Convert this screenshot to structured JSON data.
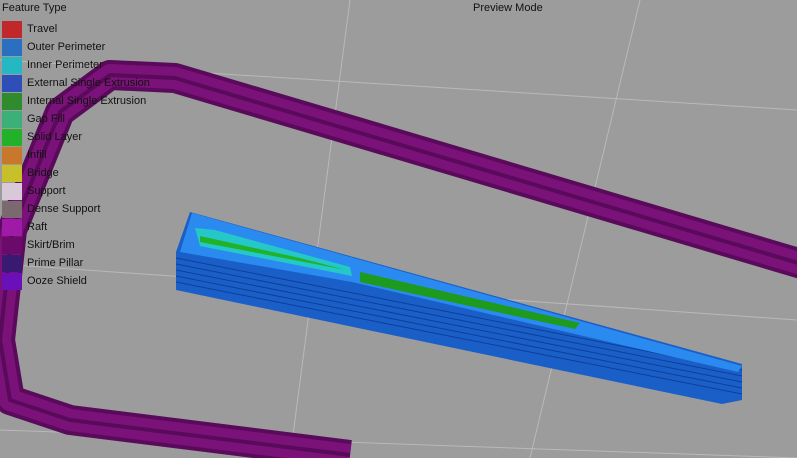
{
  "header": {
    "mode_label": "Preview Mode"
  },
  "legend": {
    "title": "Feature Type",
    "items": [
      {
        "label": "Travel",
        "color": "#c0282c"
      },
      {
        "label": "Outer Perimeter",
        "color": "#2a6fc0"
      },
      {
        "label": "Inner Perimeter",
        "color": "#25b7c2"
      },
      {
        "label": "External Single Extrusion",
        "color": "#2e4fb8"
      },
      {
        "label": "Internal Single Extrusion",
        "color": "#2e8c2e"
      },
      {
        "label": "Gap Fill",
        "color": "#3db07a"
      },
      {
        "label": "Solid Layer",
        "color": "#22b22a"
      },
      {
        "label": "Infill",
        "color": "#c8782a"
      },
      {
        "label": "Bridge",
        "color": "#c8c02a"
      },
      {
        "label": "Support",
        "color": "#d8c8d8"
      },
      {
        "label": "Dense Support",
        "color": "#7a6a70"
      },
      {
        "label": "Raft",
        "color": "#a01aa8"
      },
      {
        "label": "Skirt/Brim",
        "color": "#6a0a6a"
      },
      {
        "label": "Prime Pillar",
        "color": "#3a1a70"
      },
      {
        "label": "Ooze Shield",
        "color": "#6a10b8"
      }
    ]
  }
}
